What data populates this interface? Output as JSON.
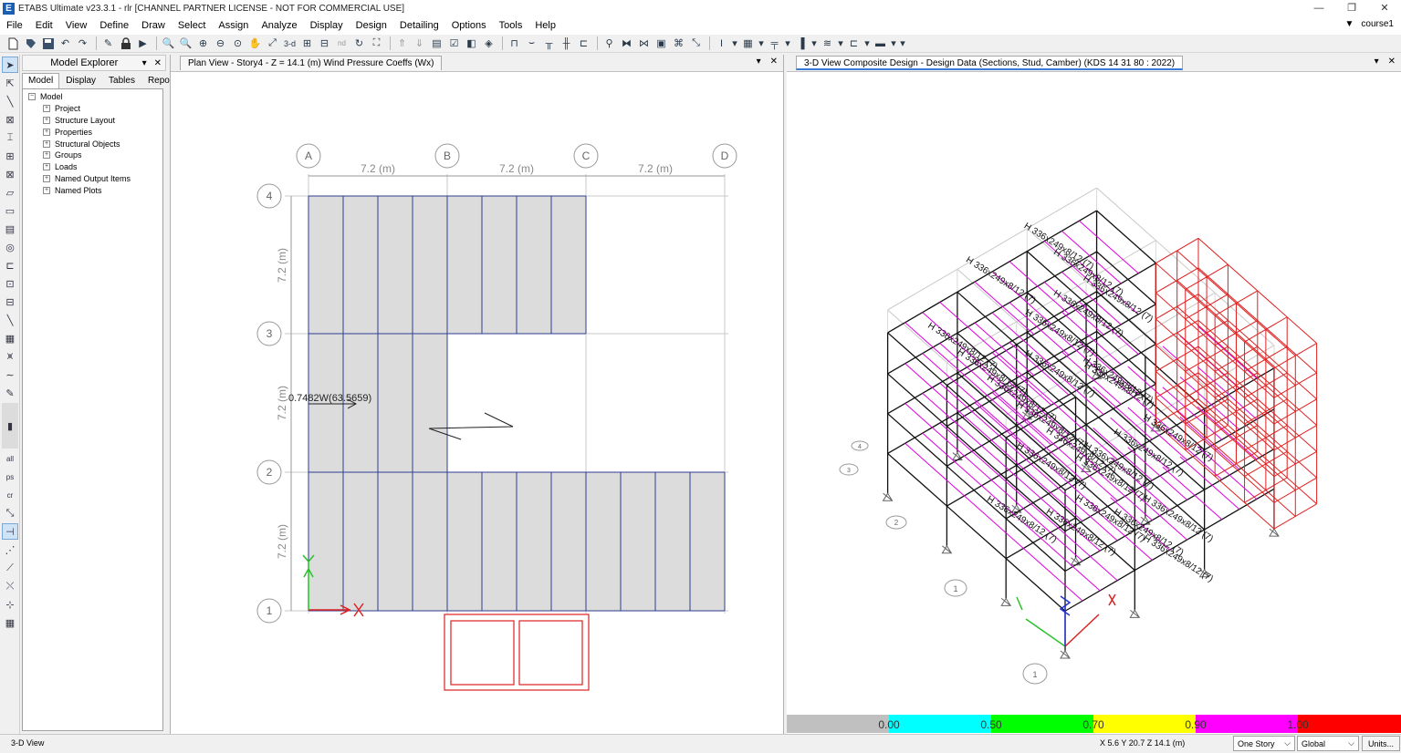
{
  "window": {
    "title": "ETABS Ultimate v23.3.1 - rlr  [CHANNEL PARTNER LICENSE - NOT FOR COMMERCIAL USE]",
    "app_icon_letter": "E",
    "minimize": "—",
    "restore": "❐",
    "close": "✕"
  },
  "menu": {
    "items": [
      "File",
      "Edit",
      "View",
      "Define",
      "Draw",
      "Select",
      "Assign",
      "Analyze",
      "Display",
      "Design",
      "Detailing",
      "Options",
      "Tools",
      "Help"
    ],
    "user_arrow": "▼",
    "user": "course1"
  },
  "explorer": {
    "title": "Model Explorer",
    "pin": "▾",
    "close": "✕",
    "tabs": [
      "Model",
      "Display",
      "Tables",
      "Reports"
    ],
    "root": "Model",
    "children": [
      "Project",
      "Structure Layout",
      "Properties",
      "Structural Objects",
      "Groups",
      "Loads",
      "Named Output Items",
      "Named Plots"
    ]
  },
  "plan_view": {
    "tab_title": "Plan View - Story4 - Z = 14.1 (m)  Wind Pressure Coeffs (Wx)",
    "grid_x": [
      "A",
      "B",
      "C",
      "D"
    ],
    "grid_y": [
      "4",
      "3",
      "2",
      "1"
    ],
    "spacing_x": [
      "7.2 (m)",
      "7.2 (m)",
      "7.2 (m)"
    ],
    "spacing_y": [
      "7.2 (m)",
      "7.2 (m)",
      "7.2 (m)"
    ],
    "wind_label": "0.7482W(63.5659)"
  },
  "view_3d": {
    "tab_title": "3-D View  Composite Design - Design Data (Sections, Stud, Camber)  (KDS 14 31 80 : 2022)",
    "section_label": "H 336x249x8/12 (7)",
    "grid_bubbles": [
      "4",
      "3",
      "2",
      "1"
    ]
  },
  "view_controls": {
    "dropdown": "▾",
    "close": "✕"
  },
  "colorbar": {
    "labels": [
      "0.00",
      "0.50",
      "0.70",
      "0.90",
      "1.00"
    ],
    "colors": [
      "#c0c0c0",
      "#00ffff",
      "#00ff00",
      "#ffff00",
      "#ff00ff",
      "#ff0000"
    ]
  },
  "status": {
    "left": "3-D View",
    "coords": "X 5.6  Y 20.7  Z 14.1 (m)",
    "story_select": "One Story",
    "coord_select": "Global",
    "units_button": "Units...",
    "select_arrow": "⌵"
  }
}
